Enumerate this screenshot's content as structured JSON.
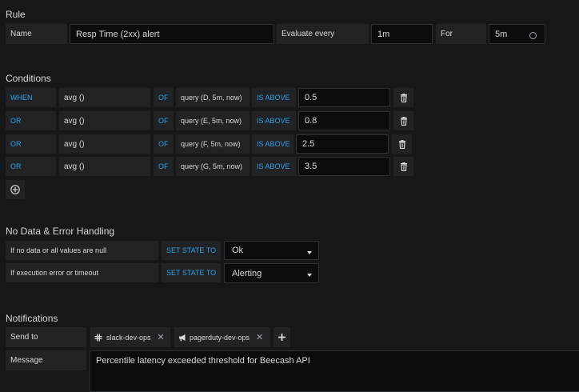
{
  "rule": {
    "section_title": "Rule",
    "name_label": "Name",
    "name_value": "Resp Time (2xx) alert",
    "evaluate_label": "Evaluate every",
    "evaluate_value": "1m",
    "for_label": "For",
    "for_value": "5m"
  },
  "conditions": {
    "section_title": "Conditions",
    "rows": [
      {
        "op": "WHEN",
        "reducer": "avg ()",
        "of": "OF",
        "query": "query (D, 5m, now)",
        "evaluator": "IS ABOVE",
        "value": "0.5"
      },
      {
        "op": "OR",
        "reducer": "avg ()",
        "of": "OF",
        "query": "query (E, 5m, now)",
        "evaluator": "IS ABOVE",
        "value": "0.8"
      },
      {
        "op": "OR",
        "reducer": "avg ()",
        "of": "OF",
        "query": "query (F, 5m, now)",
        "evaluator": "IS ABOVE",
        "value": "2.5"
      },
      {
        "op": "OR",
        "reducer": "avg ()",
        "of": "OF",
        "query": "query (G, 5m, now)",
        "evaluator": "IS ABOVE",
        "value": "3.5"
      }
    ]
  },
  "nodata": {
    "section_title": "No Data & Error Handling",
    "rows": [
      {
        "label": "If no data or all values are null",
        "keyword": "SET STATE TO",
        "value": "Ok"
      },
      {
        "label": "If execution error or timeout",
        "keyword": "SET STATE TO",
        "value": "Alerting"
      }
    ]
  },
  "notifications": {
    "section_title": "Notifications",
    "send_to_label": "Send to",
    "channels": [
      {
        "name": "slack-dev-ops",
        "icon": "slack-icon"
      },
      {
        "name": "pagerduty-dev-ops",
        "icon": "bullhorn-icon"
      }
    ],
    "message_label": "Message",
    "message_value": "Percentile latency exceeded threshold for Beecash API"
  },
  "colors": {
    "accent": "#33a2e5",
    "background": "#161719",
    "panel": "#202226",
    "input": "#0b0c0e"
  }
}
